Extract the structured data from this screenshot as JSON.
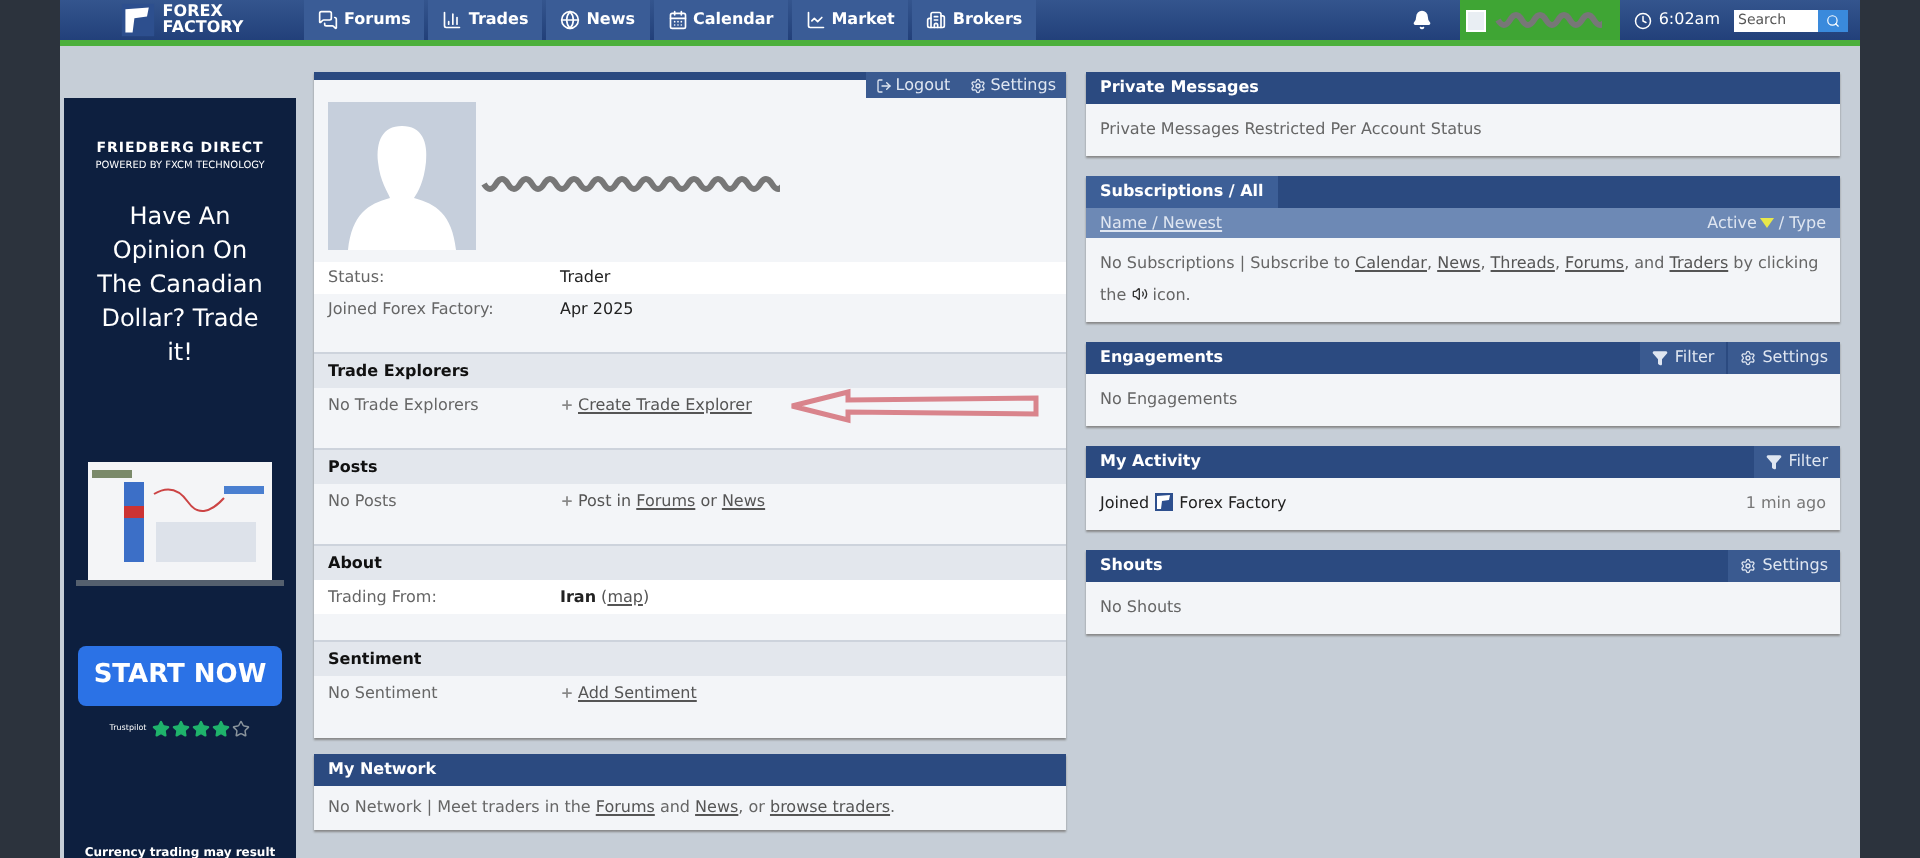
{
  "header": {
    "logo": [
      "FOREX",
      "FACTORY"
    ],
    "nav": [
      "Forums",
      "Trades",
      "News",
      "Calendar",
      "Market",
      "Brokers"
    ],
    "time": "6:02am",
    "search": {
      "placeholder": "Search"
    }
  },
  "ad": {
    "brand": "FRIEDBERG DIRECT",
    "tagline": "POWERED BY FXCM TECHNOLOGY",
    "headline": "Have An Opinion On The Canadian Dollar? Trade it!",
    "button": "START NOW",
    "rating_label": "Trustpilot",
    "stars": 4,
    "disclaimer": "Currency trading may result"
  },
  "profile": {
    "actions": [
      {
        "kind": "logout",
        "label": "Logout"
      },
      {
        "kind": "settings",
        "label": "Settings"
      }
    ],
    "info": [
      {
        "label": "Status:",
        "value": [
          {
            "text": "Trader"
          }
        ]
      },
      {
        "label": "Joined Forex Factory:",
        "value": [
          {
            "text": "Apr 2025"
          }
        ]
      }
    ],
    "sections": [
      {
        "title": "Trade Explorers",
        "label": "No Trade Explorers",
        "plus": true,
        "value": [
          {
            "text": "Create Trade Explorer",
            "link": true
          }
        ]
      },
      {
        "title": "Posts",
        "label": "No Posts",
        "plus": true,
        "value": [
          {
            "text": "Post in "
          },
          {
            "text": "Forums",
            "link": true
          },
          {
            "text": " or "
          },
          {
            "text": "News",
            "link": true
          }
        ]
      },
      {
        "title": "About",
        "label": "Trading From:",
        "plus": false,
        "value": [
          {
            "text": "Iran",
            "bold": true
          },
          {
            "text": " ("
          },
          {
            "text": "map",
            "link": true
          },
          {
            "text": ")"
          }
        ]
      },
      {
        "title": "Sentiment",
        "label": "No Sentiment",
        "plus": true,
        "value": [
          {
            "text": "Add Sentiment",
            "link": true
          }
        ]
      }
    ]
  },
  "network": {
    "title": "My Network",
    "body": [
      {
        "text": "No Network | Meet traders in the "
      },
      {
        "text": "Forums",
        "link": true
      },
      {
        "text": " and "
      },
      {
        "text": "News",
        "link": true
      },
      {
        "text": ", or "
      },
      {
        "text": "browse traders",
        "link": true
      },
      {
        "text": "."
      }
    ]
  },
  "panels": [
    {
      "title": "Private Messages",
      "body": [
        {
          "text": "Private Messages Restricted Per Account Status"
        }
      ]
    },
    {
      "title": "Subscriptions / All",
      "subheader": {
        "left": "Name / Newest",
        "right_a": "Active",
        "right_b": " / Type"
      },
      "body": [
        {
          "text": "No Subscriptions | Subscribe to "
        },
        {
          "text": "Calendar",
          "link": true
        },
        {
          "text": ", "
        },
        {
          "text": "News",
          "link": true
        },
        {
          "text": ", "
        },
        {
          "text": "Threads",
          "link": true
        },
        {
          "text": ", "
        },
        {
          "text": "Forums",
          "link": true
        },
        {
          "text": ", and "
        },
        {
          "text": "Traders",
          "link": true
        },
        {
          "text": " by clicking the "
        },
        {
          "kind": "subscribe-icon"
        },
        {
          "text": " icon."
        }
      ]
    },
    {
      "title": "Engagements",
      "actions": [
        {
          "kind": "filter",
          "label": "Filter"
        },
        {
          "kind": "settings",
          "label": "Settings"
        }
      ],
      "body": [
        {
          "text": "No Engagements"
        }
      ]
    },
    {
      "title": "My Activity",
      "actions": [
        {
          "kind": "filter",
          "label": "Filter"
        }
      ],
      "body": [
        {
          "text": "Joined ",
          "dark": true
        },
        {
          "kind": "logo"
        },
        {
          "text": " Forex Factory",
          "dark": true
        }
      ],
      "time": "1 min ago"
    },
    {
      "title": "Shouts",
      "actions": [
        {
          "kind": "settings",
          "label": "Settings"
        }
      ],
      "body": [
        {
          "text": "No Shouts"
        }
      ]
    }
  ]
}
